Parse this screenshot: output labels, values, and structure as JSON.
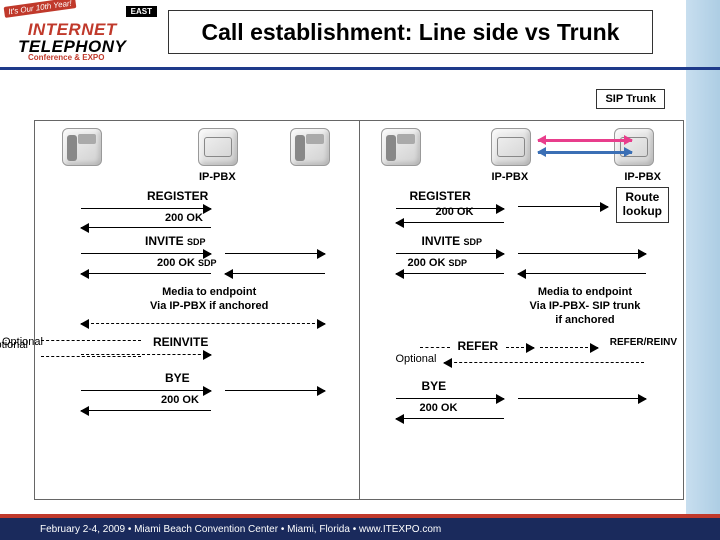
{
  "header": {
    "logo": {
      "banner": "It's Our 10th Year!",
      "east": "EAST",
      "brand_top": "INTERNET",
      "brand_bot": "TELEPHONY",
      "sub": "Conference & EXPO"
    },
    "title": "Call establishment: Line side vs Trunk"
  },
  "left": {
    "pbx_label": "IP-PBX",
    "msgs": {
      "register": "REGISTER",
      "ok1": "200 OK",
      "invite": "INVITE",
      "invite_sub": "SDP",
      "ok2": "200 OK",
      "ok2_sub": "SDP",
      "media1": "Media to endpoint",
      "media2": "Via IP-PBX if anchored",
      "reinvite": "REINVITE",
      "bye": "BYE",
      "ok3": "200 OK"
    },
    "optional": "Optional"
  },
  "right": {
    "sip_trunk": "SIP Trunk",
    "pbx_label_a": "IP-PBX",
    "pbx_label_b": "IP-PBX",
    "route": "Route\nlookup",
    "msgs": {
      "register": "REGISTER",
      "ok1": "200 OK",
      "invite": "INVITE",
      "invite_sub": "SDP",
      "ok2": "200 OK",
      "ok2_sub": "SDP",
      "media1": "Media to endpoint",
      "media2": "Via IP-PBX- SIP trunk",
      "media3": "if anchored",
      "refer": "REFER",
      "refer_reinv": "REFER/REINV",
      "bye": "BYE",
      "ok3": "200 OK"
    },
    "optional": "Optional"
  },
  "footer": "February 2-4, 2009 • Miami Beach Convention Center • Miami, Florida • www.ITEXPO.com"
}
